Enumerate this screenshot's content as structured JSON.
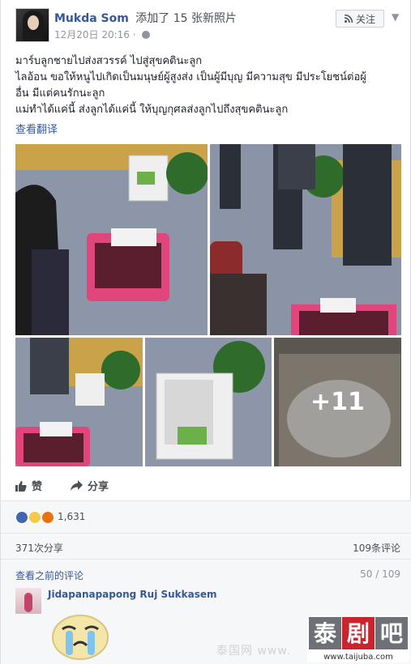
{
  "post": {
    "author": "Mukda Som",
    "action": "添加了 15 张新照片",
    "timestamp": "12月20日 20:16 ·",
    "follow_label": "关注",
    "text_lines": [
      "มาร์บลูกชายไปส่งสวรรค์ ไปสู่สุขคตินะลูก",
      "ไลอ้อน ขอให้หนูไปเกิดเป็นมนุษย์ผู้สูงส่ง เป็นผู้มีบุญ มีความสุข มีประโยชน์ต่อผู้",
      "อื่น มีแต่คนรักนะลูก",
      "แม่ทำได้แค่นี้ ส่งลูกได้แค่นี้ ให้บุญกุศลส่งลูกไปถึงสุขคตินะลูก"
    ],
    "translate_label": "查看翻译",
    "more_photos_label": "+11"
  },
  "actions": {
    "like_label": "赞",
    "share_label": "分享"
  },
  "reactions": {
    "count": "1,631"
  },
  "stats": {
    "shares": "371次分享",
    "comments": "109条评论"
  },
  "previous": {
    "link": "查看之前的评论",
    "pager": "50 / 109"
  },
  "comment": {
    "author": "Jidapanapapong Ruj Sukkasem"
  },
  "watermark": {
    "brand": "泰剧吧",
    "url": "www.taijuba.com",
    "site": "泰国网 www."
  },
  "colors": {
    "link": "#365899",
    "like_blue": "#4267b2",
    "sad_yellow": "#f7c948",
    "angry_red": "#e9710f",
    "carrier_pink": "#e0457b"
  }
}
